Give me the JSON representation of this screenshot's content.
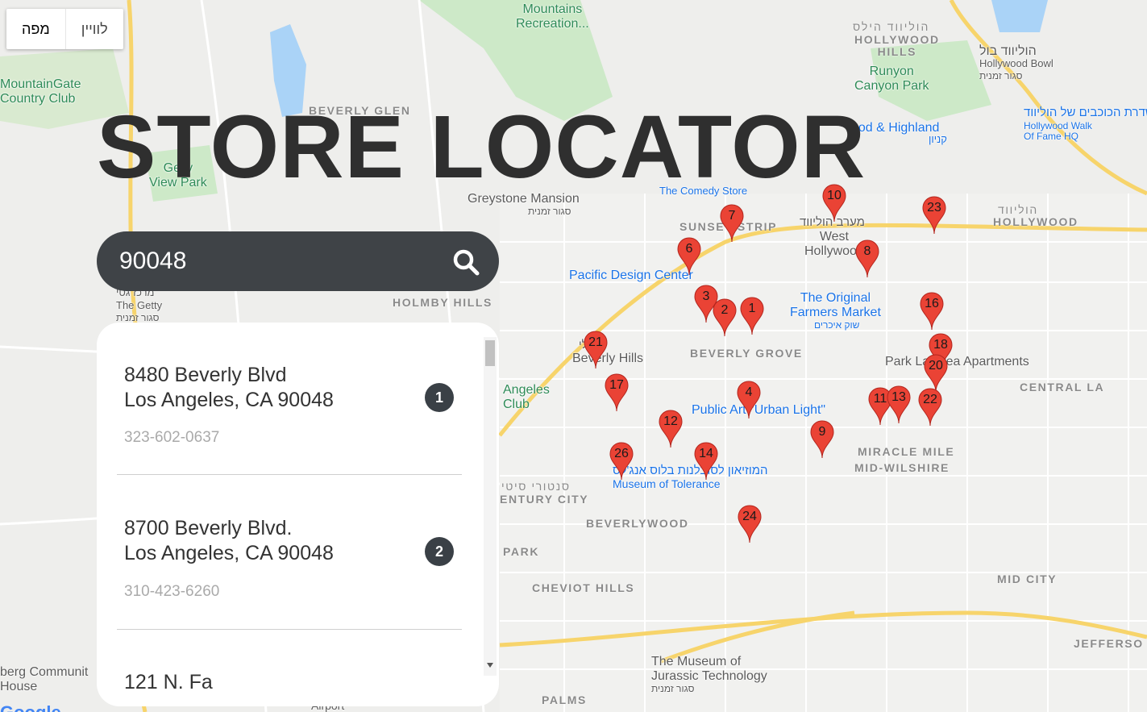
{
  "map_type_control": {
    "map_label": "מפה",
    "satellite_label": "לוויין"
  },
  "title": "STORE LOCATOR",
  "search": {
    "value": "90048"
  },
  "results": [
    {
      "address_line1": "8480 Beverly Blvd",
      "address_line2": "Los Angeles, CA 90048",
      "phone": "323-602-0637",
      "number": "1"
    },
    {
      "address_line1": "8700 Beverly Blvd.",
      "address_line2": "Los Angeles, CA 90048",
      "phone": "310-423-6260",
      "number": "2"
    },
    {
      "address_line1": "121 N. Fa",
      "address_line2": "",
      "phone": "",
      "number": ""
    }
  ],
  "markers": [
    "1",
    "2",
    "3",
    "4",
    "6",
    "7",
    "8",
    "9",
    "10",
    "11",
    "12",
    "13",
    "14",
    "16",
    "17",
    "18",
    "20",
    "21",
    "22",
    "23",
    "24",
    "26"
  ],
  "map_labels": {
    "mountains_recreation": "Mountains\nRecreation...",
    "hollywood_hills_he": "הוליווד הילס",
    "hollywood_hills": "HOLLYWOOD\nHILLS",
    "hollywood_bowl_he": "הוליווד בול",
    "hollywood_bowl": "Hollywood Bowl",
    "closed_temp_1": "סגור זמנית",
    "runyon": "Runyon\nCanyon Park",
    "walk_of_fame_he": "שדרת הכוכבים של הוליווד",
    "walk_of_fame": "Hollywood Walk\nOf Fame HQ",
    "mountaingate": "MountainGate\nCountry Club",
    "beverly_glen": "BEVERLY GLEN",
    "hollywood_highland": "ood & Highland",
    "mall_he": "קניון",
    "gelly_park": "Gelly\nView Park",
    "comedy_store": "The Comedy Store",
    "greystone": "Greystone Mansion",
    "closed_temp_2": "סגור זמנית",
    "sunset_strip": "SUNSET STRIP",
    "west_hollywood_he": "מערב הוליווד",
    "west_hollywood": "West\nHollywood",
    "hollywood_district_he": "הוליווד",
    "hollywood_district": "HOLLYWOOD",
    "pacific_design": "Pacific Design Center",
    "getty_he": "מרכז גטי",
    "getty": "The Getty",
    "closed_temp_3": "סגור זמנית",
    "holmby_hills": "HOLMBY HILLS",
    "original_farmers": "The Original\nFarmers Market",
    "farmers_he": "שוק איכרים",
    "park_la_brea": "Park La Brea Apartments",
    "beverly_hills_he": "בוורלי",
    "beverly_hills": "Beverly Hills",
    "beverly_grove": "BEVERLY GROVE",
    "central_la": "CENTRAL LA",
    "la_club": "Angeles\nClub",
    "public_art": "Public Art \"Urban Light\"",
    "miracle_mile": "MIRACLE MILE",
    "mid_wilshire": "MID-WILSHIRE",
    "museum_tolerance_he": "המוזיאון לסובלנות בלוס אנג'לס",
    "museum_tolerance": "Museum of Tolerance",
    "century_city_he": "סנטורי סיטי",
    "century_city": "ENTURY CITY",
    "beverlywood": "BEVERLYWOOD",
    "park": "PARK",
    "cheviot_hills": "CHEVIOT HILLS",
    "mid_city": "MID CITY",
    "jefferson": "JEFFERSO",
    "jurassic": "The Museum of\nJurassic Technology",
    "closed_temp_4": "סגור זמנית",
    "palms": "PALMS",
    "community_house": "berg Communit\nHouse",
    "airport": "Airport",
    "google": "Google"
  },
  "colors": {
    "accent_dark": "#3f4347",
    "marker_red": "#ea4335",
    "map_bg": "#eeeeec"
  }
}
